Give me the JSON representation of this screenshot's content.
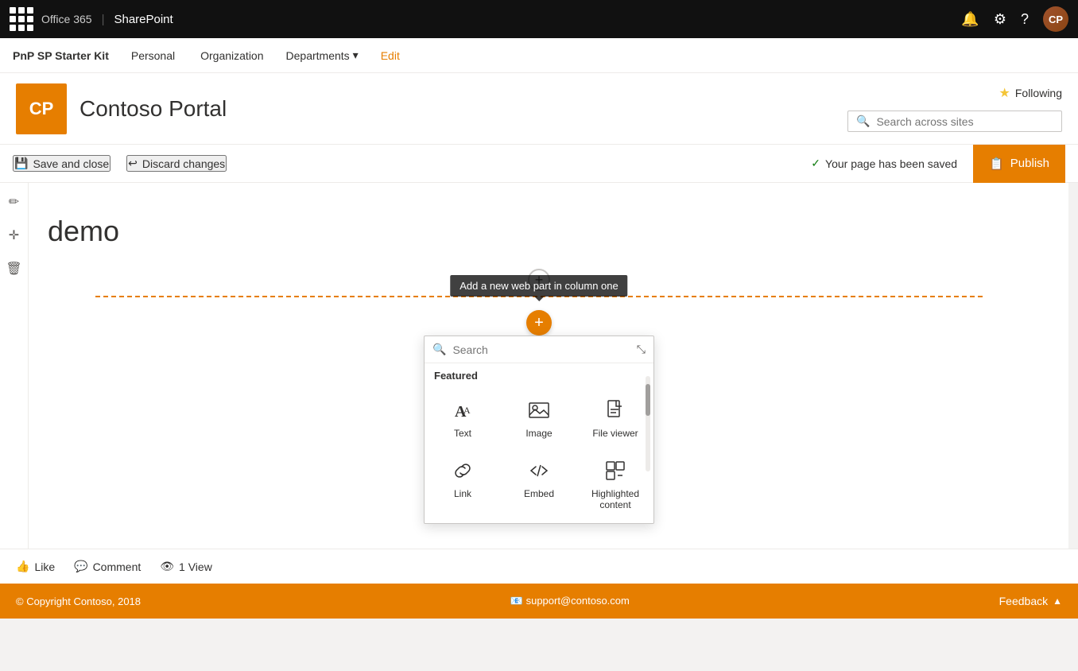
{
  "topnav": {
    "office_label": "Office 365",
    "separator": "|",
    "sharepoint_label": "SharePoint",
    "notification_icon": "🔔",
    "settings_icon": "⚙",
    "help_icon": "?",
    "avatar_initials": "CP"
  },
  "secondnav": {
    "site_name": "PnP SP Starter Kit",
    "links": [
      {
        "label": "Personal"
      },
      {
        "label": "Organization"
      },
      {
        "label": "Departments"
      },
      {
        "label": "Edit",
        "style": "edit"
      }
    ]
  },
  "portal": {
    "logo_text": "CP",
    "title": "Contoso Portal",
    "following_label": "Following",
    "search_placeholder": "Search across sites"
  },
  "toolbar": {
    "save_label": "Save and close",
    "discard_label": "Discard changes",
    "saved_status": "Your page has been saved",
    "publish_label": "Publish"
  },
  "page": {
    "title": "demo",
    "add_webpart_tooltip": "Add a new web part in column one"
  },
  "webpart_picker": {
    "search_placeholder": "Search",
    "featured_label": "Featured",
    "items": [
      {
        "id": "text",
        "label": "Text",
        "icon": "text"
      },
      {
        "id": "image",
        "label": "Image",
        "icon": "image"
      },
      {
        "id": "file-viewer",
        "label": "File viewer",
        "icon": "file"
      },
      {
        "id": "link",
        "label": "Link",
        "icon": "link"
      },
      {
        "id": "embed",
        "label": "Embed",
        "icon": "embed"
      },
      {
        "id": "highlighted-content",
        "label": "Highlighted content",
        "icon": "highlight"
      }
    ]
  },
  "page_footer": {
    "like_label": "Like",
    "comment_label": "Comment",
    "views_label": "1 View"
  },
  "site_footer": {
    "copyright": "© Copyright Contoso, 2018",
    "support_email": "support@contoso.com",
    "feedback_label": "Feedback"
  }
}
